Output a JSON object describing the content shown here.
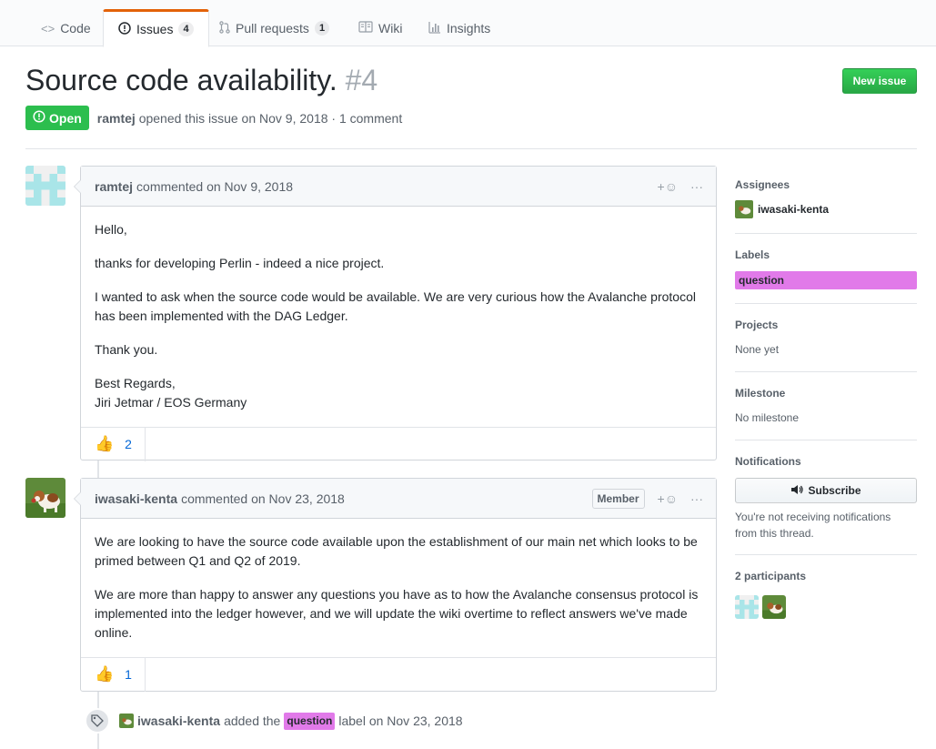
{
  "tabs": [
    {
      "label": "Code",
      "icon": "code-icon"
    },
    {
      "label": "Issues",
      "icon": "issue-opened-icon",
      "count": "4"
    },
    {
      "label": "Pull requests",
      "icon": "git-pull-request-icon",
      "count": "1"
    },
    {
      "label": "Wiki",
      "icon": "book-icon"
    },
    {
      "label": "Insights",
      "icon": "graph-icon"
    }
  ],
  "issue": {
    "title": "Source code availability.",
    "number": "#4",
    "new_issue_label": "New issue",
    "state": "Open",
    "author": "ramtej",
    "opened_text": "opened this issue on Nov 9, 2018 · 1 comment"
  },
  "comments": [
    {
      "author": "ramtej",
      "meta": "commented on Nov 9, 2018",
      "body": [
        "Hello,",
        "thanks for developing Perlin - indeed a nice project.",
        "I wanted to ask when the source code would be available. We are very curious how the Avalanche protocol has been implemented with the DAG Ledger.",
        "Thank you."
      ],
      "signoff_1": "Best Regards,",
      "signoff_2": "Jiri Jetmar / EOS Germany",
      "reaction_count": "2"
    },
    {
      "author": "iwasaki-kenta",
      "meta": "commented on Nov 23, 2018",
      "badge": "Member",
      "body": [
        "We are looking to have the source code available upon the establishment of our main net which looks to be primed between Q1 and Q2 of 2019.",
        "We are more than happy to answer any questions you have as to how the Avalanche consensus protocol is implemented into the ledger however, and we will update the wiki overtime to reflect answers we've made online."
      ],
      "reaction_count": "1"
    }
  ],
  "reaction_icon": "thumbs-up-icon",
  "comment_actions": {
    "add_reaction": "+☺",
    "more": "···"
  },
  "label_event": {
    "actor": "iwasaki-kenta",
    "action": "added the",
    "label": "question",
    "suffix": "label on Nov 23, 2018"
  },
  "sidebar": {
    "assignees_heading": "Assignees",
    "assignee": "iwasaki-kenta",
    "labels_heading": "Labels",
    "label": "question",
    "projects_heading": "Projects",
    "projects_value": "None yet",
    "milestone_heading": "Milestone",
    "milestone_value": "No milestone",
    "notifications_heading": "Notifications",
    "subscribe_label": "Subscribe",
    "notifications_note": "You're not receiving notifications from this thread.",
    "participants_heading": "2 participants"
  },
  "colors": {
    "open_green": "#2cbe4e",
    "question_label": "#e17ae9",
    "active_tab_accent": "#e36209",
    "link_blue": "#0366d6"
  }
}
